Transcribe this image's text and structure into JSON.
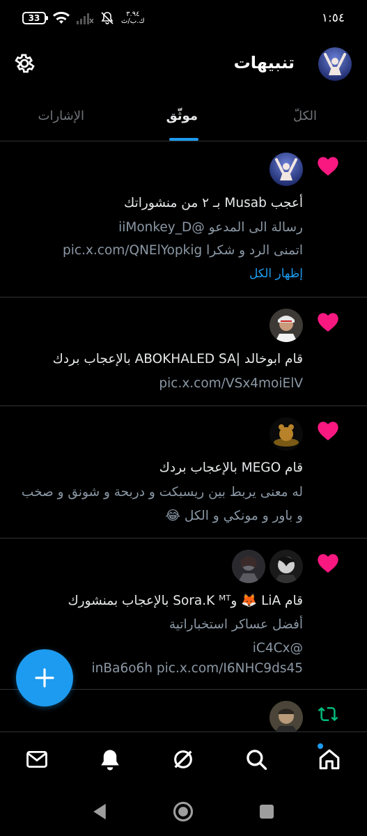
{
  "status_bar": {
    "time": "١:٥٤",
    "battery": "33",
    "network_speed_value": "٣.٩٤",
    "network_speed_unit": "ك.ب/ث"
  },
  "header": {
    "title": "تنبيهات"
  },
  "tabs": [
    {
      "label": "الكلّ",
      "active": false
    },
    {
      "label": "موثّق",
      "active": true
    },
    {
      "label": "الإشارات",
      "active": false
    }
  ],
  "notifications": [
    {
      "type": "like",
      "lines": [
        "أعجب Musab بـ ٢ من منشوراتك",
        "رسالة الى المدعو @iiMonkey_D",
        "اتمنى الرد و شكرا pic.x.com/QNElYopkig"
      ],
      "show_all": "إظهار الكل"
    },
    {
      "type": "like",
      "lines": [
        "قام ابوخالد |ABOKHALED SA بالإعجاب بردك",
        "pic.x.com/VSx4moiElV"
      ]
    },
    {
      "type": "like",
      "lines": [
        "قام MEGO بالإعجاب بردك",
        "له معنى يربط بين ريسبكت و دربحة و شونق و صخب",
        "و باور و مونكي و الكل 😂"
      ]
    },
    {
      "type": "like",
      "lines": [
        "قام LiA 🦊 وSora.K ᴹᵀ بالإعجاب بمنشورك",
        "أفضل عساكر استخباراتية",
        "@iC4Cx",
        "inBa6o6h pic.x.com/I6NHC9ds45"
      ]
    },
    {
      "type": "repost",
      "lines": []
    }
  ],
  "bottom_nav": [
    "home-icon",
    "search-icon",
    "grok-icon",
    "notifications-icon",
    "messages-icon"
  ],
  "colors": {
    "accent": "#1d9bf0",
    "heart": "#f91880",
    "repost": "#00ba7c",
    "background": "#000000",
    "text_secondary": "#8b98a5"
  }
}
